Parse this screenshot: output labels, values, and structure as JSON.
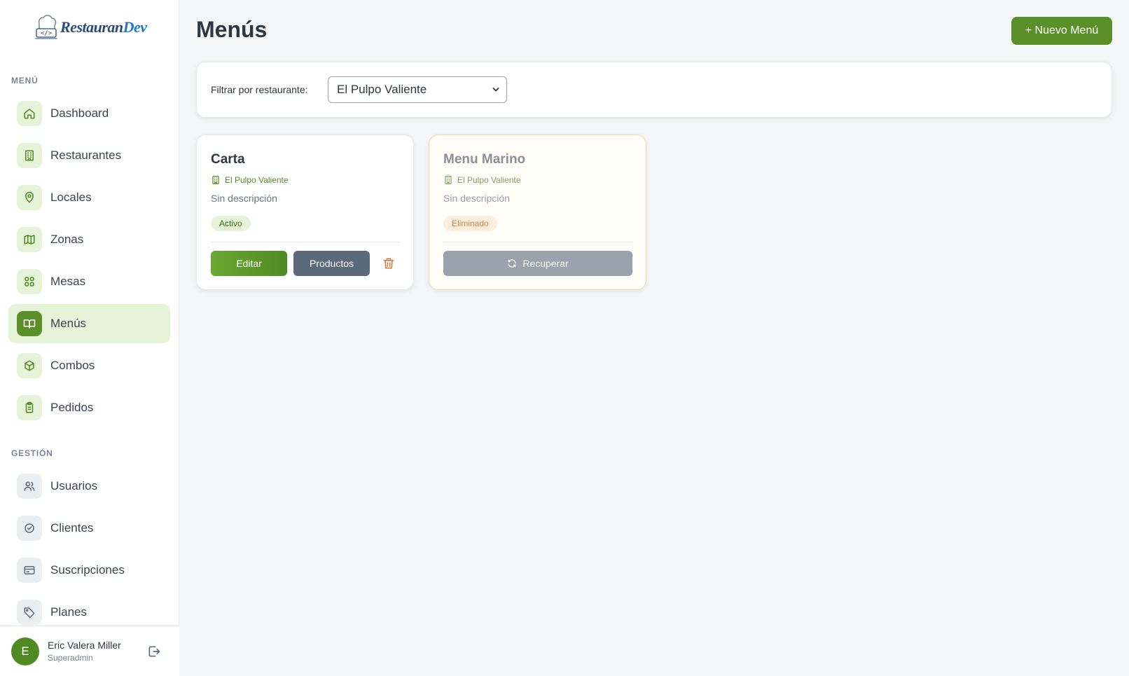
{
  "app": {
    "logo_prefix": "Restauran",
    "logo_suffix": "Dev"
  },
  "sidebar": {
    "section_menu": "MENÚ",
    "section_gestion": "GESTIÓN",
    "items": [
      {
        "label": "Dashboard",
        "icon": "home-icon"
      },
      {
        "label": "Restaurantes",
        "icon": "building-icon"
      },
      {
        "label": "Locales",
        "icon": "map-pin-icon"
      },
      {
        "label": "Zonas",
        "icon": "map-icon"
      },
      {
        "label": "Mesas",
        "icon": "grid-icon"
      },
      {
        "label": "Menús",
        "icon": "book-icon",
        "active": true
      },
      {
        "label": "Combos",
        "icon": "box-icon"
      },
      {
        "label": "Pedidos",
        "icon": "clipboard-icon"
      }
    ],
    "gestion_items": [
      {
        "label": "Usuarios",
        "icon": "users-icon"
      },
      {
        "label": "Clientes",
        "icon": "check-circle-icon"
      },
      {
        "label": "Suscripciones",
        "icon": "credit-card-icon"
      },
      {
        "label": "Planes",
        "icon": "tag-icon"
      }
    ],
    "user": {
      "initial": "E",
      "name": "Eric Valera Miller",
      "role": "Superadmin"
    }
  },
  "main": {
    "title": "Menús",
    "new_button": "+ Nuevo Menú",
    "filter": {
      "label": "Filtrar por restaurante:",
      "selected": "El Pulpo Valiente"
    },
    "cards": [
      {
        "title": "Carta",
        "restaurant": "El Pulpo Valiente",
        "description": "Sin descripción",
        "status": "Activo",
        "edit_label": "Editar",
        "products_label": "Productos"
      },
      {
        "title": "Menu Marino",
        "restaurant": "El Pulpo Valiente",
        "description": "Sin descripción",
        "status": "Eliminado",
        "recover_label": "Recuperar"
      }
    ]
  },
  "colors": {
    "accent": "#5a8f2a",
    "accent_light": "#e6f3d9",
    "danger": "#d0814a",
    "slate": "#5a6a7a"
  }
}
